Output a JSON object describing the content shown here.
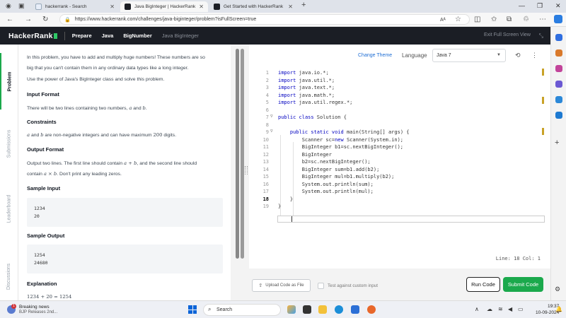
{
  "browser": {
    "tabs": [
      {
        "title": "hackerrank - Search",
        "active": false
      },
      {
        "title": "Java BigInteger | HackerRank",
        "active": true
      },
      {
        "title": "Get Started with HackerRank",
        "active": false
      }
    ],
    "new_tab": "+",
    "url": "https://www.hackerrank.com/challenges/java-biginteger/problem?isFullScreen=true"
  },
  "header": {
    "logo_text": "HackerRank",
    "breadcrumbs": [
      "Prepare",
      "Java",
      "BigNumber",
      "Java BigInteger"
    ],
    "exit_fullscreen": "Exit Full Screen View"
  },
  "side_tabs": [
    "Problem",
    "Submissions",
    "Leaderboard",
    "Discussions"
  ],
  "problem": {
    "intro_1a": "In this problem, you have to add and multiply huge numbers! These numbers are so",
    "intro_1b": "big that you can't contain them in any ordinary data types like a long integer.",
    "intro_2": "Use the power of Java's BigInteger class and solve this problem.",
    "input_format_title": "Input Format",
    "input_format_pre": "There will be two lines containing two numbers, ",
    "var_a": "a",
    "and": " and ",
    "var_b": "b",
    "period": ".",
    "constraints_title": "Constraints",
    "constraints_mid": " and ",
    "constraints_post": " are non-negative integers and can have maximum ",
    "constraints_num": "200",
    "constraints_end": " digits.",
    "output_format_title": "Output Format",
    "output_line1_pre": "Output two lines. The first line should contain ",
    "expr_sum": "a + b",
    "output_line1_post": ", and the second line should",
    "output_line2_pre": "contain ",
    "expr_mul": "a × b",
    "output_line2_post": ". Don't print any leading zeros.",
    "sample_input_title": "Sample Input",
    "sample_input": "1234\n20",
    "sample_output_title": "Sample Output",
    "sample_output": "1254\n24680",
    "explanation_title": "Explanation",
    "explanation_line": "1234 + 20 = 1254"
  },
  "editor_toolbar": {
    "change_theme": "Change  Theme",
    "language_label": "Language",
    "language_value": "Java 7"
  },
  "code": {
    "line_numbers": [
      "1",
      "2",
      "3",
      "4",
      "5",
      "6",
      "7",
      "8",
      "9",
      "10",
      "11",
      "12",
      "13",
      "14",
      "15",
      "16",
      "17",
      "18",
      "19"
    ],
    "lines": [
      "import java.io.*;",
      "import java.util.*;",
      "import java.text.*;",
      "import java.math.*;",
      "import java.util.regex.*;",
      "",
      "public class Solution {",
      "",
      "    public static void main(String[] args) {",
      "        Scanner sc=new Scanner(System.in);",
      "        BigInteger b1=sc.nextBigInteger();",
      "        BigInteger",
      "        b2=sc.nextBigInteger();",
      "        BigInteger sum=b1.add(b2);",
      "        BigInteger mul=b1.multiply(b2);",
      "        System.out.println(sum);",
      "        System.out.println(mul);",
      "    }",
      "}"
    ],
    "status": "Line: 18 Col: 1",
    "current_line": 18
  },
  "actions": {
    "upload": "Upload Code as File",
    "custom_input": "Test against custom input",
    "run": "Run Code",
    "submit": "Submit Code"
  },
  "taskbar": {
    "news_badge": "1",
    "news_title": "Breaking news",
    "news_sub": "BJP Releases 2nd...",
    "search": "Search",
    "time": "19:37",
    "date": "10-09-2024"
  },
  "colors": {
    "accent_green": "#1ba94c",
    "header_dark": "#1b1e25",
    "link_blue": "#1f6ed4"
  }
}
